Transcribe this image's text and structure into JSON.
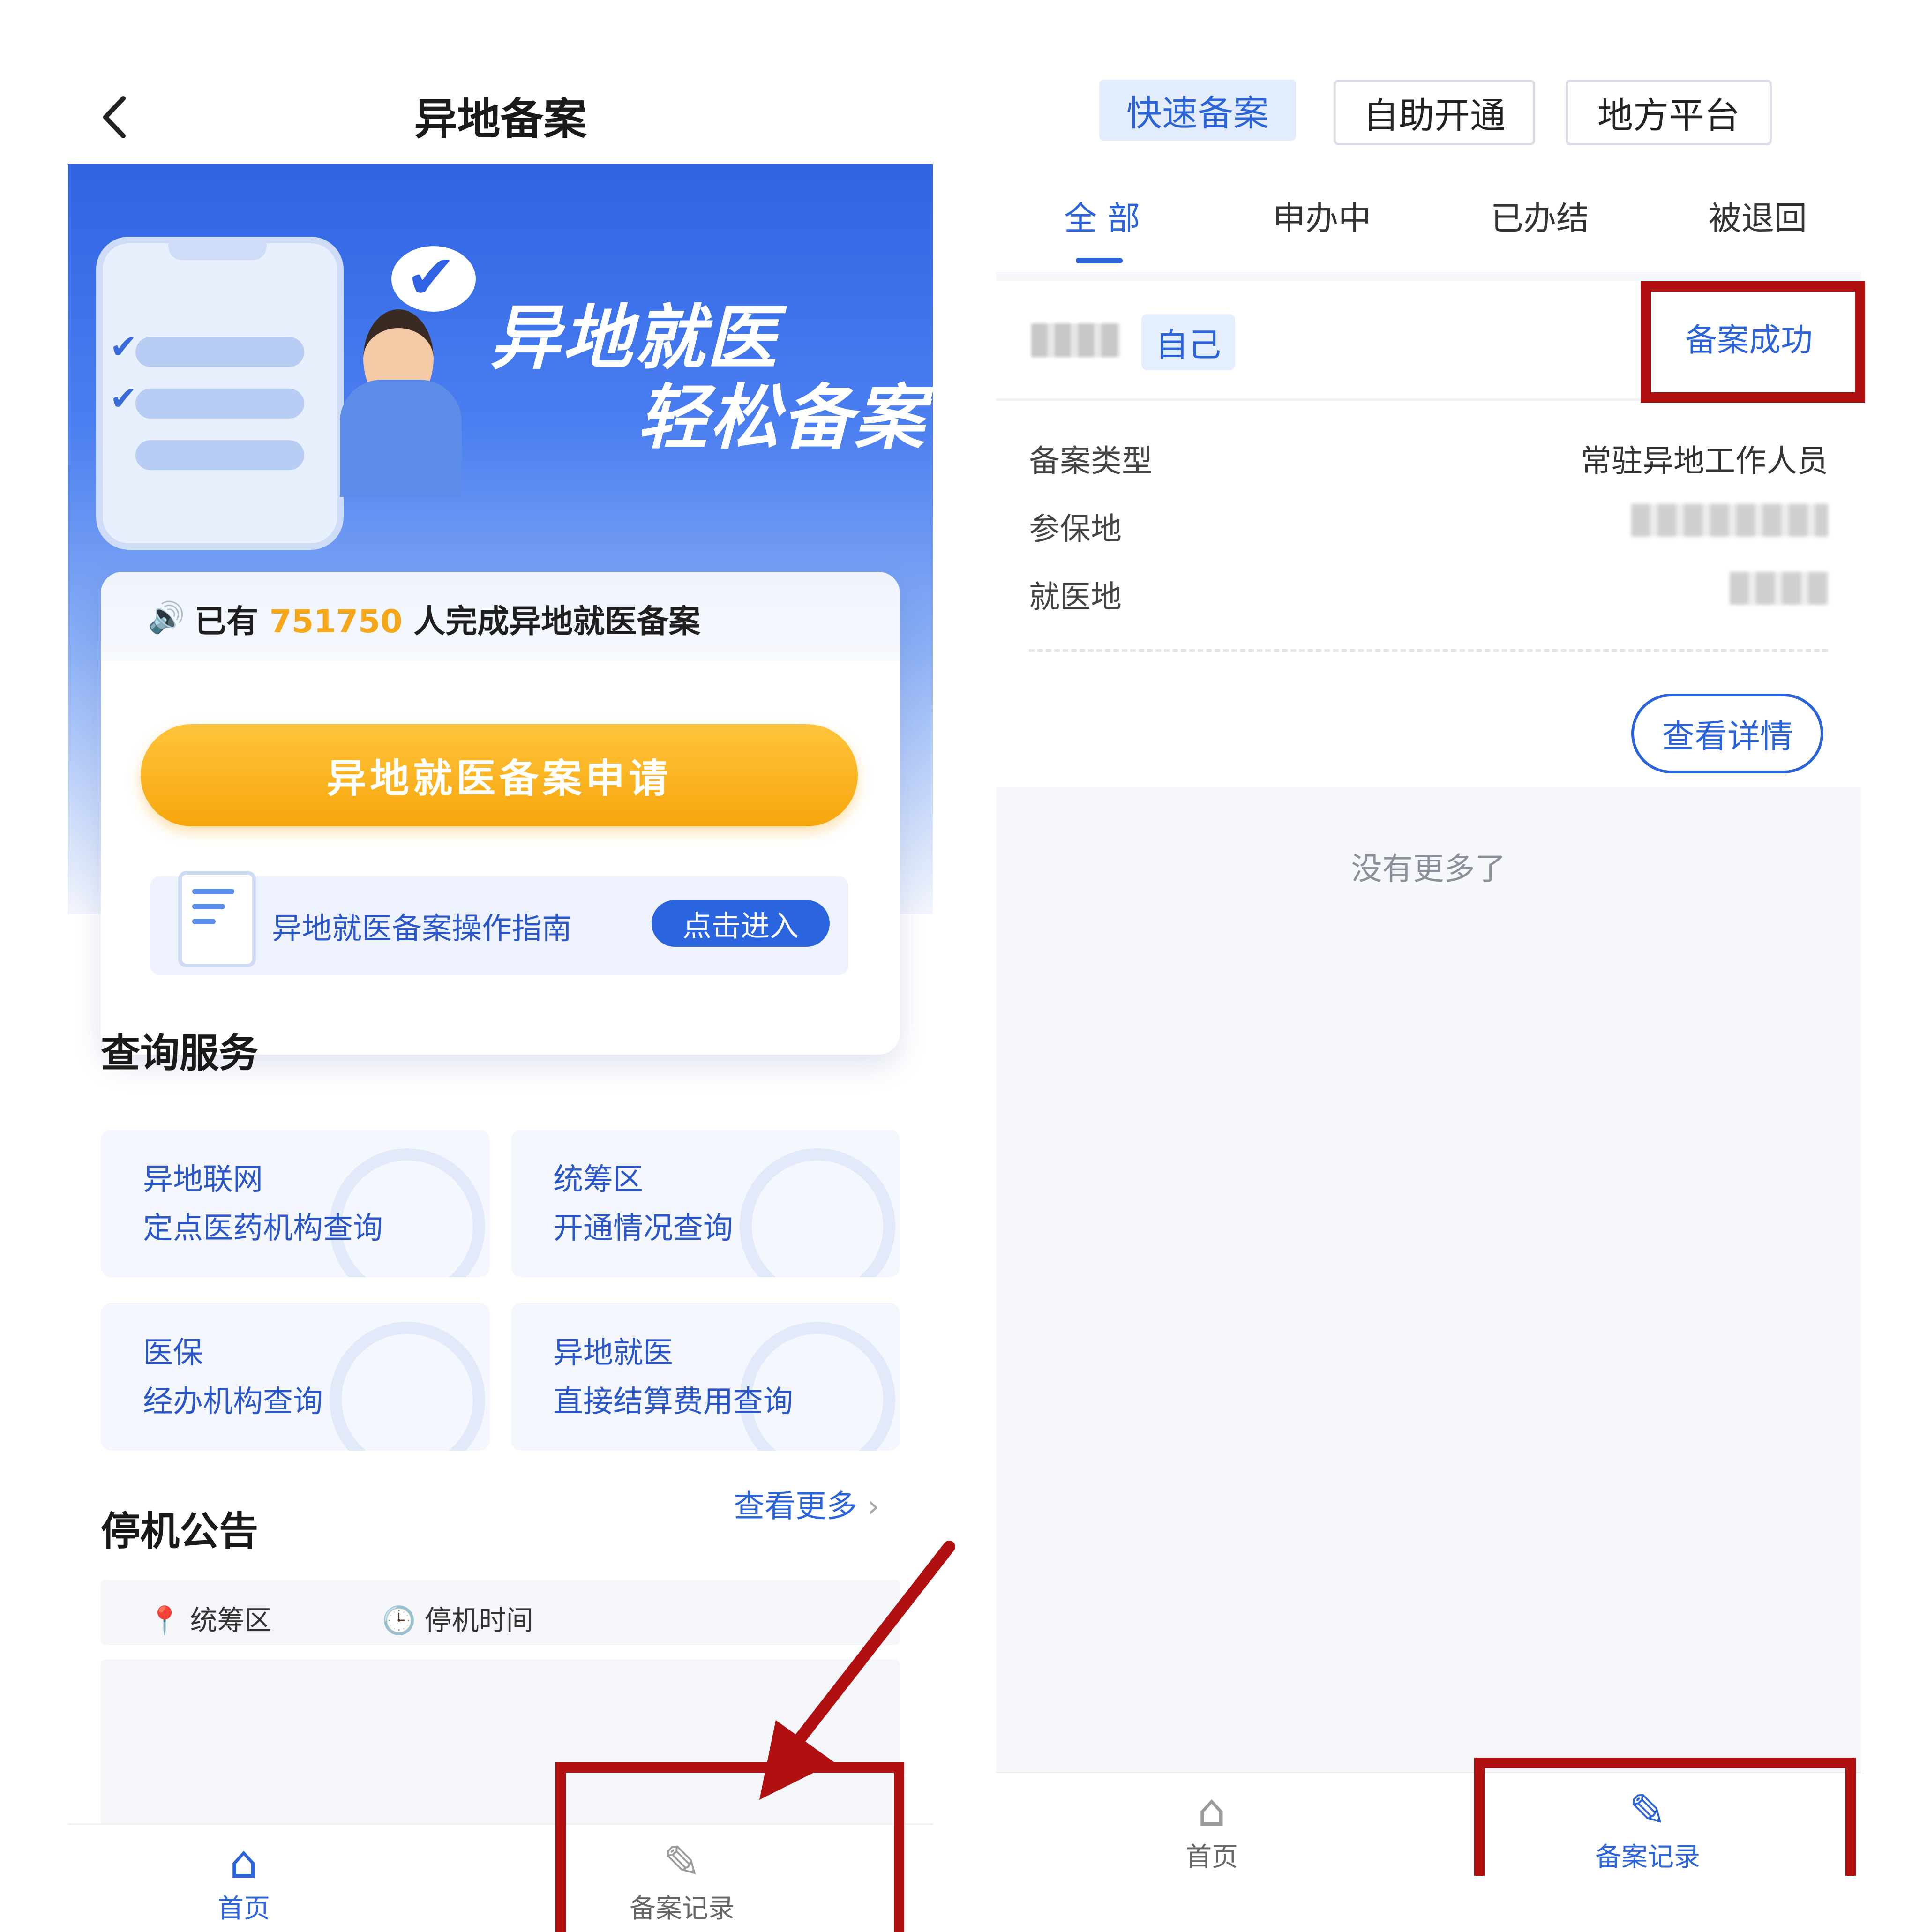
{
  "left": {
    "title": "异地备案",
    "banner": {
      "line1": "异地就医",
      "line2": "轻松备案"
    },
    "notice": {
      "prefix": "已有",
      "count": "751750",
      "suffix": "人完成异地就医备案"
    },
    "apply_button": "异地就医备案申请",
    "guide": {
      "label": "异地就医备案操作指南",
      "button": "点击进入"
    },
    "query_section": {
      "title": "查询服务",
      "items": [
        {
          "line1": "异地联网",
          "line2": "定点医药机构查询"
        },
        {
          "line1": "统筹区",
          "line2": "开通情况查询"
        },
        {
          "line1": "医保",
          "line2": "经办机构查询"
        },
        {
          "line1": "异地就医",
          "line2": "直接结算费用查询"
        }
      ]
    },
    "announcement": {
      "title": "停机公告",
      "more": "查看更多",
      "columns": [
        "统筹区",
        "停机时间"
      ]
    },
    "tabbar": {
      "home": "首页",
      "records": "备案记录"
    }
  },
  "right": {
    "segments": [
      "快速备案",
      "自助开通",
      "地方平台"
    ],
    "filters": [
      "全 部",
      "申办中",
      "已办结",
      "被退回"
    ],
    "record": {
      "tag": "自己",
      "status": "备案成功",
      "fields": [
        {
          "label": "备案类型",
          "value": "常驻异地工作人员"
        },
        {
          "label": "参保地",
          "value": ""
        },
        {
          "label": "就医地",
          "value": ""
        }
      ],
      "detail_button": "查看详情"
    },
    "no_more": "没有更多了",
    "tabbar": {
      "home": "首页",
      "records": "备案记录"
    }
  },
  "colors": {
    "primary": "#2b63d9",
    "accent_orange": "#f7a60d",
    "annotation_red": "#b01010"
  },
  "icons": [
    "back-chevron-icon",
    "speaker-icon",
    "document-icon",
    "location-pin-icon",
    "clock-icon",
    "home-icon",
    "edit-record-icon",
    "arrow-annotation-icon"
  ]
}
